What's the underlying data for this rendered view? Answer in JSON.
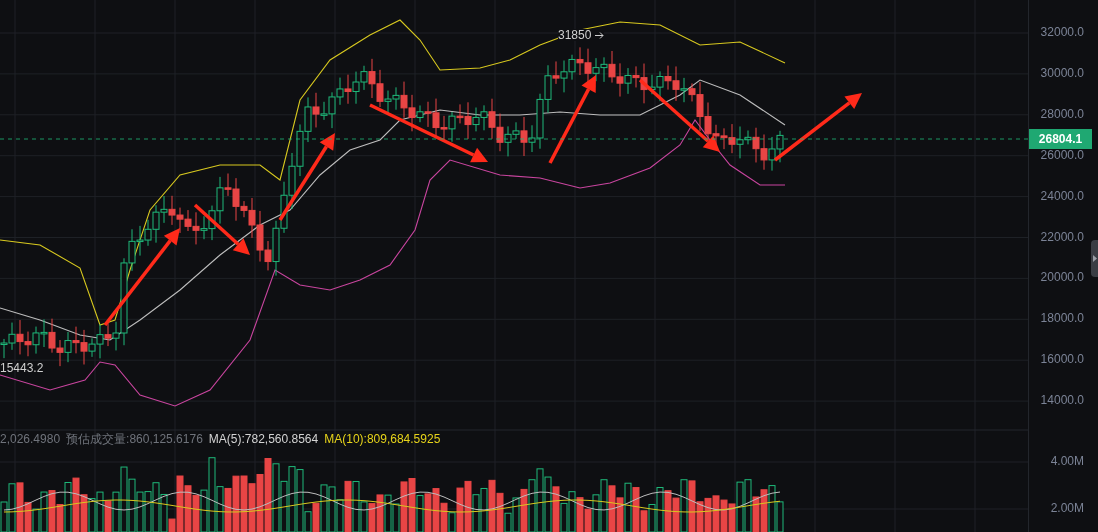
{
  "price_chart": {
    "high_marker": "31850",
    "low_marker": "15443.2",
    "last_price": "26804.1",
    "axis_ticks": [
      "32000.0",
      "30000.0",
      "28000.0",
      "26000.0",
      "24000.0",
      "22000.0",
      "20000.0",
      "18000.0",
      "16000.0",
      "14000.0"
    ]
  },
  "volume_panel": {
    "legend": [
      {
        "kind": "muted",
        "text": "2,026.4980"
      },
      {
        "kind": "muted",
        "text": "预估成交量:860,125.6176"
      },
      {
        "kind": "ma5",
        "text": "MA(5):782,560.8564"
      },
      {
        "kind": "ma10",
        "text": "MA(10):809,684.5925"
      }
    ],
    "axis_ticks": [
      "4.00M",
      "2.00M"
    ]
  }
}
